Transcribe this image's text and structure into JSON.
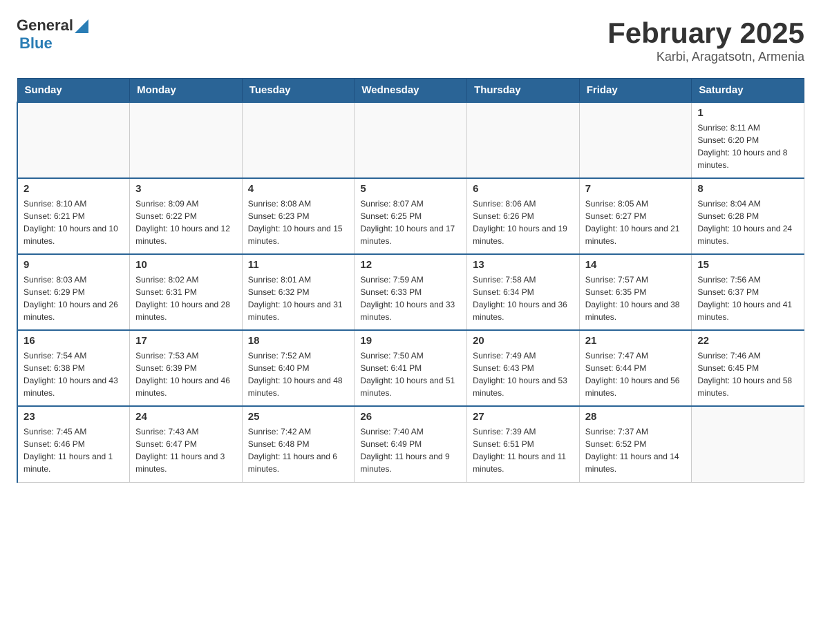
{
  "header": {
    "logo_general": "General",
    "logo_blue": "Blue",
    "month_title": "February 2025",
    "location": "Karbi, Aragatsotn, Armenia"
  },
  "weekdays": [
    "Sunday",
    "Monday",
    "Tuesday",
    "Wednesday",
    "Thursday",
    "Friday",
    "Saturday"
  ],
  "weeks": [
    [
      {
        "day": "",
        "info": ""
      },
      {
        "day": "",
        "info": ""
      },
      {
        "day": "",
        "info": ""
      },
      {
        "day": "",
        "info": ""
      },
      {
        "day": "",
        "info": ""
      },
      {
        "day": "",
        "info": ""
      },
      {
        "day": "1",
        "info": "Sunrise: 8:11 AM\nSunset: 6:20 PM\nDaylight: 10 hours and 8 minutes."
      }
    ],
    [
      {
        "day": "2",
        "info": "Sunrise: 8:10 AM\nSunset: 6:21 PM\nDaylight: 10 hours and 10 minutes."
      },
      {
        "day": "3",
        "info": "Sunrise: 8:09 AM\nSunset: 6:22 PM\nDaylight: 10 hours and 12 minutes."
      },
      {
        "day": "4",
        "info": "Sunrise: 8:08 AM\nSunset: 6:23 PM\nDaylight: 10 hours and 15 minutes."
      },
      {
        "day": "5",
        "info": "Sunrise: 8:07 AM\nSunset: 6:25 PM\nDaylight: 10 hours and 17 minutes."
      },
      {
        "day": "6",
        "info": "Sunrise: 8:06 AM\nSunset: 6:26 PM\nDaylight: 10 hours and 19 minutes."
      },
      {
        "day": "7",
        "info": "Sunrise: 8:05 AM\nSunset: 6:27 PM\nDaylight: 10 hours and 21 minutes."
      },
      {
        "day": "8",
        "info": "Sunrise: 8:04 AM\nSunset: 6:28 PM\nDaylight: 10 hours and 24 minutes."
      }
    ],
    [
      {
        "day": "9",
        "info": "Sunrise: 8:03 AM\nSunset: 6:29 PM\nDaylight: 10 hours and 26 minutes."
      },
      {
        "day": "10",
        "info": "Sunrise: 8:02 AM\nSunset: 6:31 PM\nDaylight: 10 hours and 28 minutes."
      },
      {
        "day": "11",
        "info": "Sunrise: 8:01 AM\nSunset: 6:32 PM\nDaylight: 10 hours and 31 minutes."
      },
      {
        "day": "12",
        "info": "Sunrise: 7:59 AM\nSunset: 6:33 PM\nDaylight: 10 hours and 33 minutes."
      },
      {
        "day": "13",
        "info": "Sunrise: 7:58 AM\nSunset: 6:34 PM\nDaylight: 10 hours and 36 minutes."
      },
      {
        "day": "14",
        "info": "Sunrise: 7:57 AM\nSunset: 6:35 PM\nDaylight: 10 hours and 38 minutes."
      },
      {
        "day": "15",
        "info": "Sunrise: 7:56 AM\nSunset: 6:37 PM\nDaylight: 10 hours and 41 minutes."
      }
    ],
    [
      {
        "day": "16",
        "info": "Sunrise: 7:54 AM\nSunset: 6:38 PM\nDaylight: 10 hours and 43 minutes."
      },
      {
        "day": "17",
        "info": "Sunrise: 7:53 AM\nSunset: 6:39 PM\nDaylight: 10 hours and 46 minutes."
      },
      {
        "day": "18",
        "info": "Sunrise: 7:52 AM\nSunset: 6:40 PM\nDaylight: 10 hours and 48 minutes."
      },
      {
        "day": "19",
        "info": "Sunrise: 7:50 AM\nSunset: 6:41 PM\nDaylight: 10 hours and 51 minutes."
      },
      {
        "day": "20",
        "info": "Sunrise: 7:49 AM\nSunset: 6:43 PM\nDaylight: 10 hours and 53 minutes."
      },
      {
        "day": "21",
        "info": "Sunrise: 7:47 AM\nSunset: 6:44 PM\nDaylight: 10 hours and 56 minutes."
      },
      {
        "day": "22",
        "info": "Sunrise: 7:46 AM\nSunset: 6:45 PM\nDaylight: 10 hours and 58 minutes."
      }
    ],
    [
      {
        "day": "23",
        "info": "Sunrise: 7:45 AM\nSunset: 6:46 PM\nDaylight: 11 hours and 1 minute."
      },
      {
        "day": "24",
        "info": "Sunrise: 7:43 AM\nSunset: 6:47 PM\nDaylight: 11 hours and 3 minutes."
      },
      {
        "day": "25",
        "info": "Sunrise: 7:42 AM\nSunset: 6:48 PM\nDaylight: 11 hours and 6 minutes."
      },
      {
        "day": "26",
        "info": "Sunrise: 7:40 AM\nSunset: 6:49 PM\nDaylight: 11 hours and 9 minutes."
      },
      {
        "day": "27",
        "info": "Sunrise: 7:39 AM\nSunset: 6:51 PM\nDaylight: 11 hours and 11 minutes."
      },
      {
        "day": "28",
        "info": "Sunrise: 7:37 AM\nSunset: 6:52 PM\nDaylight: 11 hours and 14 minutes."
      },
      {
        "day": "",
        "info": ""
      }
    ]
  ]
}
